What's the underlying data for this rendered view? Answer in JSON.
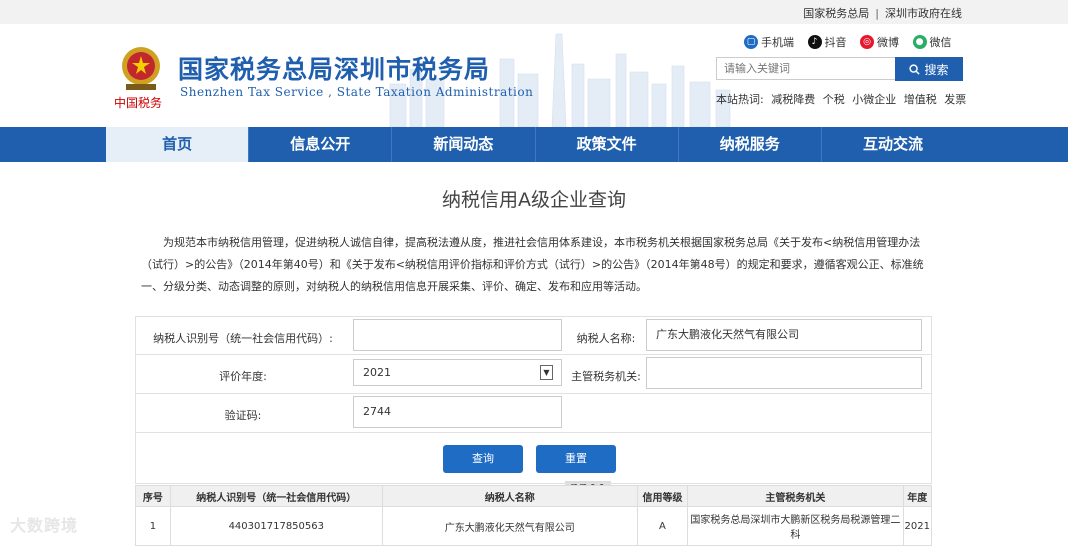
{
  "top_links": [
    "国家税务总局",
    "深圳市政府在线"
  ],
  "header": {
    "emblem_caption": "中国税务",
    "title_cn": "国家税务总局深圳市税务局",
    "title_en": "Shenzhen Tax Service , State Taxation Administration"
  },
  "social": [
    {
      "label": "手机端",
      "icon": "mobile-icon",
      "color": "#1f6cc4"
    },
    {
      "label": "抖音",
      "icon": "douyin-icon",
      "color": "#111111"
    },
    {
      "label": "微博",
      "icon": "weibo-icon",
      "color": "#e6162d"
    },
    {
      "label": "微信",
      "icon": "wechat-icon",
      "color": "#2aae67"
    }
  ],
  "search": {
    "placeholder": "请输入关键词",
    "button": "搜索"
  },
  "hot": {
    "label": "本站热词:",
    "terms": [
      "减税降费",
      "个税",
      "小微企业",
      "增值税",
      "发票"
    ]
  },
  "nav": [
    "首页",
    "信息公开",
    "新闻动态",
    "政策文件",
    "纳税服务",
    "互动交流"
  ],
  "page_title": "纳税信用A级企业查询",
  "intro": "为规范本市纳税信用管理，促进纳税人诚信自律，提高税法遵从度，推进社会信用体系建设，本市税务机关根据国家税务总局《关于发布<纳税信用管理办法（试行）>的公告》（2014年第40号）和《关于发布<纳税信用评价指标和评价方式（试行）>的公告》（2014年第48号）的规定和要求，遵循客观公正、标准统一、分级分类、动态调整的原则，对纳税人的纳税信用信息开展采集、评价、确定、发布和应用等活动。",
  "form": {
    "taxpayer_id_label": "纳税人识别号（统一社会信用代码）:",
    "taxpayer_id_value": "",
    "taxpayer_name_label": "纳税人名称:",
    "taxpayer_name_value": "广东大鹏液化天然气有限公司",
    "year_label": "评价年度:",
    "year_value": "2021",
    "authority_label": "主管税务机关:",
    "authority_value": "",
    "captcha_label": "验证码:",
    "captcha_value": "2744",
    "captcha_image_text": "2744",
    "query_button": "查询",
    "reset_button": "重置"
  },
  "table": {
    "headers": [
      "序号",
      "纳税人识别号（统一社会信用代码）",
      "纳税人名称",
      "信用等级",
      "主管税务机关",
      "年度"
    ],
    "rows": [
      [
        "1",
        "440301717850563",
        "广东大鹏液化天然气有限公司",
        "A",
        "国家税务总局深圳市大鹏新区税务局税源管理二科",
        "2021"
      ]
    ]
  },
  "watermark": "大数跨境",
  "colors": {
    "primary": "#1f5fae",
    "nav_active_bg": "#e6eef8"
  }
}
